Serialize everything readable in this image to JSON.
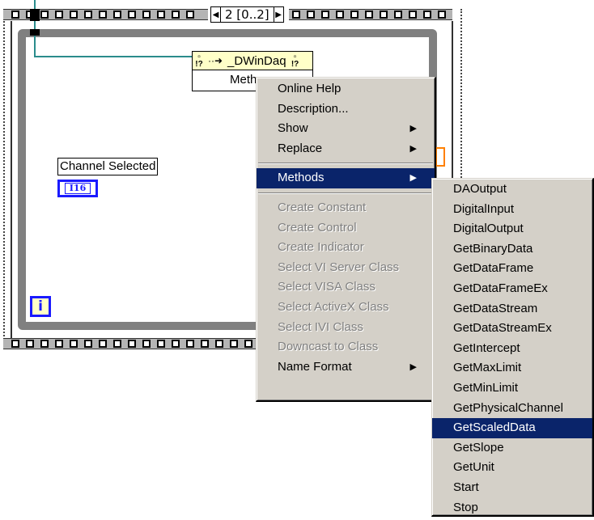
{
  "sequence_structure": {
    "selector_label": "2 [0..2]",
    "prev_icon": "left-triangle",
    "next_icon": "right-triangle"
  },
  "property_node": {
    "class_name": "_DWinDaq",
    "property_label": "Meth",
    "icons": [
      "reference-icon",
      "arrow-icon",
      "error-icon"
    ]
  },
  "control": {
    "label": "Channel Selected",
    "type": "I16"
  },
  "iteration_terminal": {
    "label": "i"
  },
  "context_menu": {
    "items": [
      {
        "label": "Online Help",
        "enabled": true,
        "submenu": false
      },
      {
        "label": "Description...",
        "enabled": true,
        "submenu": false
      },
      {
        "label": "Show",
        "enabled": true,
        "submenu": true
      },
      {
        "label": "Replace",
        "enabled": true,
        "submenu": true
      },
      {
        "separator": true
      },
      {
        "label": "Methods",
        "enabled": true,
        "submenu": true,
        "active": true
      },
      {
        "separator": true
      },
      {
        "label": "Create Constant",
        "enabled": false
      },
      {
        "label": "Create Control",
        "enabled": false
      },
      {
        "label": "Create Indicator",
        "enabled": false
      },
      {
        "label": "Select VI Server Class",
        "enabled": false
      },
      {
        "label": "Select VISA Class",
        "enabled": false
      },
      {
        "label": "Select ActiveX Class",
        "enabled": false
      },
      {
        "label": "Select IVI Class",
        "enabled": false
      },
      {
        "label": "Downcast to Class",
        "enabled": false
      },
      {
        "label": "Name Format",
        "enabled": true,
        "submenu": true
      }
    ]
  },
  "methods_submenu": {
    "items": [
      {
        "label": "DAOutput"
      },
      {
        "label": "DigitalInput"
      },
      {
        "label": "DigitalOutput"
      },
      {
        "label": "GetBinaryData"
      },
      {
        "label": "GetDataFrame"
      },
      {
        "label": "GetDataFrameEx"
      },
      {
        "label": "GetDataStream"
      },
      {
        "label": "GetDataStreamEx"
      },
      {
        "label": "GetIntercept"
      },
      {
        "label": "GetMaxLimit"
      },
      {
        "label": "GetMinLimit"
      },
      {
        "label": "GetPhysicalChannel"
      },
      {
        "label": "GetScaledData",
        "active": true
      },
      {
        "label": "GetSlope"
      },
      {
        "label": "GetUnit"
      },
      {
        "label": "Start"
      },
      {
        "label": "Stop"
      }
    ]
  },
  "colors": {
    "menu_bg": "#d4d0c8",
    "highlight": "#0a246a",
    "wire": "#2a8c8c",
    "i16_blue": "#1a1aff",
    "node_yellow": "#ffffc8"
  }
}
